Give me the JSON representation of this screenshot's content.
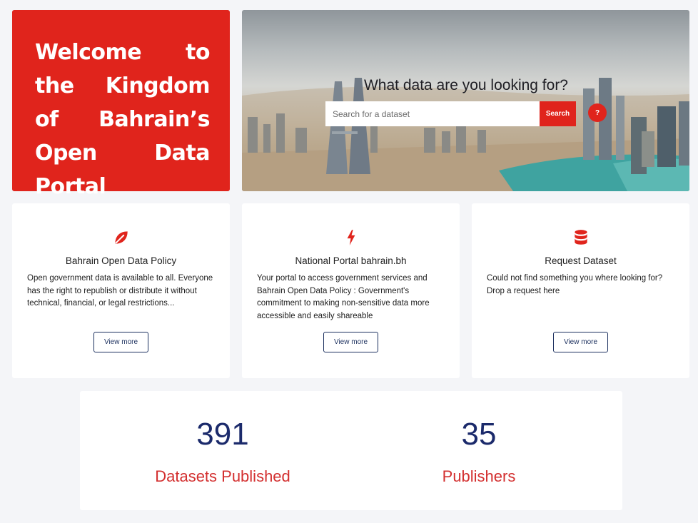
{
  "welcome": {
    "title": "Welcome to the Kingdom of Bahrain’s Open Data Portal"
  },
  "hero": {
    "question": "What data are you looking for?",
    "search_placeholder": "Search for a dataset",
    "search_button": "Search",
    "help_button": "?"
  },
  "cards": [
    {
      "icon": "leaf-icon",
      "title": "Bahrain Open Data Policy",
      "description": "Open government data is available to all. Everyone has the right to republish or distribute it without technical, financial, or legal restrictions...",
      "button": "View more"
    },
    {
      "icon": "lightning-icon",
      "title": "National Portal bahrain.bh",
      "description": "Your portal to access government services and Bahrain Open Data Policy : Government's commitment to making non-sensitive data more accessible and easily shareable",
      "button": "View more"
    },
    {
      "icon": "database-icon",
      "title": "Request Dataset",
      "description": "Could not find something you where looking for? Drop a request here",
      "button": "View more"
    }
  ],
  "stats": {
    "datasets": {
      "value": "391",
      "label": "Datasets Published"
    },
    "publishers": {
      "value": "35",
      "label": "Publishers"
    }
  },
  "colors": {
    "accent_red": "#e0241c",
    "navy": "#1b2a6b",
    "stat_label_red": "#d32f2f"
  }
}
